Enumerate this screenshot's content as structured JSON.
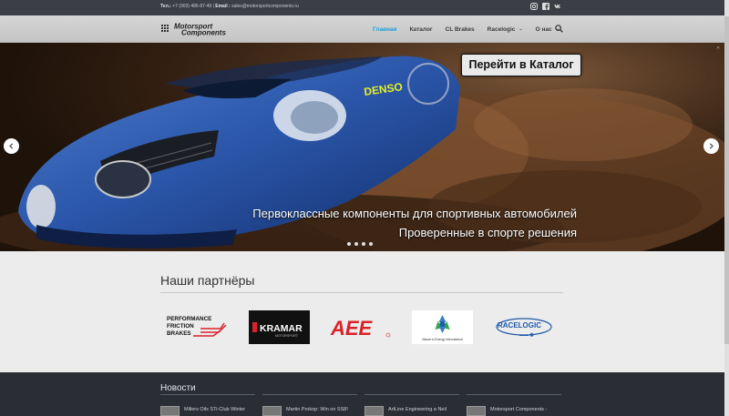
{
  "topbar": {
    "phone_label": "Тел.:",
    "phone": "+7 (903) 486-87-49",
    "email_label": "Email :",
    "email": "sales@motorsportcomponents.ru",
    "socials": [
      "instagram-icon",
      "facebook-icon",
      "vk-icon"
    ]
  },
  "header": {
    "logo_line1": "Motorsport",
    "logo_line2": "Components",
    "nav": [
      {
        "label": "Главная",
        "active": true,
        "dropdown": false
      },
      {
        "label": "Каталог",
        "active": false,
        "dropdown": false
      },
      {
        "label": "CL Brakes",
        "active": false,
        "dropdown": false
      },
      {
        "label": "Racelogic",
        "active": false,
        "dropdown": true
      },
      {
        "label": "О нас",
        "active": false,
        "dropdown": true
      }
    ],
    "caret": "⌄"
  },
  "hero": {
    "cta": "Перейти в Каталог",
    "caption_line1": "Первоклассные компоненты для спортивных автомобилей",
    "caption_line2": "Проверенные в спорте решения",
    "slides_count": 4,
    "active_slide": 1
  },
  "partners": {
    "title": "Наши партнёры",
    "logos": [
      {
        "name": "performance-friction",
        "line1": "PERFORMANCE",
        "line2": "FRICTION",
        "line3": "BRAKES"
      },
      {
        "name": "kramar",
        "line1": "KRAMAR",
        "line2": "MOTORSPORT"
      },
      {
        "name": "aee",
        "line1": "AEE"
      },
      {
        "name": "waste-to-energy",
        "line1": "Waste to Energy International"
      },
      {
        "name": "racelogic",
        "line1": "RACELOGIC"
      }
    ]
  },
  "news": {
    "title": "Новости",
    "items": [
      {
        "text": "Millers Oils STi-Club Winter"
      },
      {
        "text": "Martin Prokop: Win on SS8!"
      },
      {
        "text": "ArtLine Engineering и Neil"
      },
      {
        "text": "Motorsport Components -"
      }
    ]
  },
  "colors": {
    "accent": "#1a9fd8",
    "topbar": "#3b3f45",
    "footer": "#2a2d34",
    "kramar_bg": "#111111",
    "aee_red": "#d8222a",
    "racelogic_blue": "#1d5aa8"
  }
}
